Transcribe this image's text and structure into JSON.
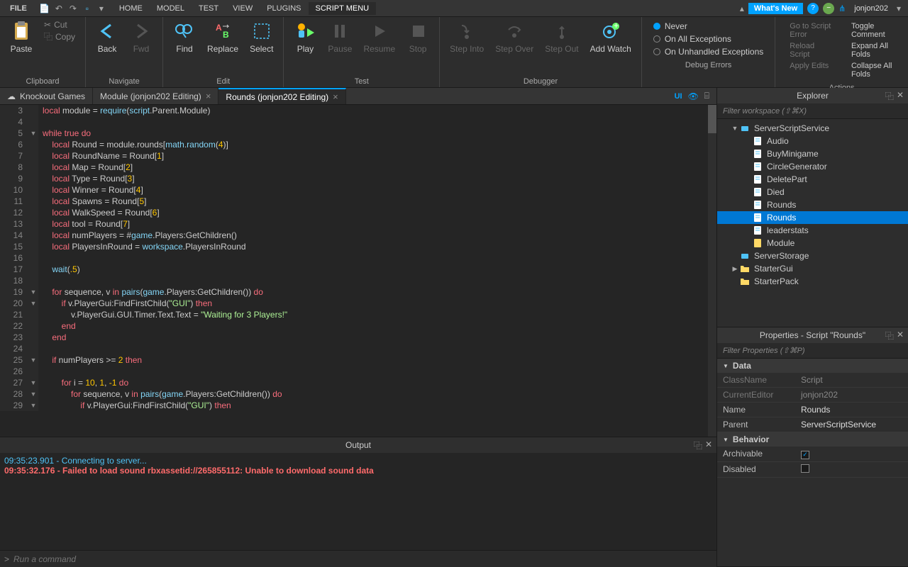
{
  "menubar": {
    "items": [
      "FILE",
      "HOME",
      "MODEL",
      "TEST",
      "VIEW",
      "PLUGINS",
      "SCRIPT MENU"
    ],
    "active": 6,
    "whatsnew": "What's New",
    "username": "jonjon202"
  },
  "ribbon": {
    "clipboard": {
      "paste": "Paste",
      "cut": "Cut",
      "copy": "Copy",
      "label": "Clipboard"
    },
    "navigate": {
      "back": "Back",
      "fwd": "Fwd",
      "label": "Navigate"
    },
    "edit": {
      "find": "Find",
      "replace": "Replace",
      "select": "Select",
      "label": "Edit"
    },
    "test": {
      "play": "Play",
      "pause": "Pause",
      "resume": "Resume",
      "stop": "Stop",
      "label": "Test"
    },
    "debugger": {
      "stepinto": "Step Into",
      "stepover": "Step Over",
      "stepout": "Step Out",
      "addwatch": "Add Watch",
      "label": "Debugger"
    },
    "debugerrors": {
      "never": "Never",
      "allexc": "On All Exceptions",
      "unhandled": "On Unhandled Exceptions",
      "label": "Debug Errors"
    },
    "actions": {
      "gotoerr": "Go to Script Error",
      "reload": "Reload Script",
      "applyedits": "Apply Edits",
      "togglecomment": "Toggle Comment",
      "expandall": "Expand All Folds",
      "collapseall": "Collapse All Folds",
      "label": "Actions"
    }
  },
  "tabs": [
    {
      "label": "Knockout Games",
      "icon": "cloud",
      "active": false,
      "closeable": false
    },
    {
      "label": "Module (jonjon202 Editing)",
      "icon": "",
      "active": false,
      "closeable": true
    },
    {
      "label": "Rounds (jonjon202 Editing)",
      "icon": "",
      "active": true,
      "closeable": true
    }
  ],
  "ui_badge": "UI",
  "code": {
    "lines": [
      {
        "n": 3,
        "f": "",
        "tokens": [
          [
            "kw",
            "local"
          ],
          [
            "ident",
            " module "
          ],
          [
            "ident",
            "= "
          ],
          [
            "fn",
            "require"
          ],
          [
            "ident",
            "("
          ],
          [
            "fn",
            "script"
          ],
          [
            "ident",
            ".Parent.Module)"
          ]
        ]
      },
      {
        "n": 4,
        "f": "",
        "tokens": []
      },
      {
        "n": 5,
        "f": "▼",
        "tokens": [
          [
            "kw",
            "while true do"
          ]
        ]
      },
      {
        "n": 6,
        "f": "",
        "tokens": [
          [
            "ident",
            "    "
          ],
          [
            "kw",
            "local"
          ],
          [
            "ident",
            " Round = module.rounds["
          ],
          [
            "fn",
            "math"
          ],
          [
            "ident",
            "."
          ],
          [
            "fn",
            "random"
          ],
          [
            "ident",
            "("
          ],
          [
            "num",
            "4"
          ],
          [
            "ident",
            ")]"
          ]
        ]
      },
      {
        "n": 7,
        "f": "",
        "tokens": [
          [
            "ident",
            "    "
          ],
          [
            "kw",
            "local"
          ],
          [
            "ident",
            " RoundName = Round["
          ],
          [
            "num",
            "1"
          ],
          [
            "ident",
            "]"
          ]
        ]
      },
      {
        "n": 8,
        "f": "",
        "tokens": [
          [
            "ident",
            "    "
          ],
          [
            "kw",
            "local"
          ],
          [
            "ident",
            " Map = Round["
          ],
          [
            "num",
            "2"
          ],
          [
            "ident",
            "]"
          ]
        ]
      },
      {
        "n": 9,
        "f": "",
        "tokens": [
          [
            "ident",
            "    "
          ],
          [
            "kw",
            "local"
          ],
          [
            "ident",
            " Type = Round["
          ],
          [
            "num",
            "3"
          ],
          [
            "ident",
            "]"
          ]
        ]
      },
      {
        "n": 10,
        "f": "",
        "tokens": [
          [
            "ident",
            "    "
          ],
          [
            "kw",
            "local"
          ],
          [
            "ident",
            " Winner = Round["
          ],
          [
            "num",
            "4"
          ],
          [
            "ident",
            "]"
          ]
        ]
      },
      {
        "n": 11,
        "f": "",
        "tokens": [
          [
            "ident",
            "    "
          ],
          [
            "kw",
            "local"
          ],
          [
            "ident",
            " Spawns = Round["
          ],
          [
            "num",
            "5"
          ],
          [
            "ident",
            "]"
          ]
        ]
      },
      {
        "n": 12,
        "f": "",
        "tokens": [
          [
            "ident",
            "    "
          ],
          [
            "kw",
            "local"
          ],
          [
            "ident",
            " WalkSpeed = Round["
          ],
          [
            "num",
            "6"
          ],
          [
            "ident",
            "]"
          ]
        ]
      },
      {
        "n": 13,
        "f": "",
        "tokens": [
          [
            "ident",
            "    "
          ],
          [
            "kw",
            "local"
          ],
          [
            "ident",
            " tool = Round["
          ],
          [
            "num",
            "7"
          ],
          [
            "ident",
            "]"
          ]
        ]
      },
      {
        "n": 14,
        "f": "",
        "tokens": [
          [
            "ident",
            "    "
          ],
          [
            "kw",
            "local"
          ],
          [
            "ident",
            " numPlayers = #"
          ],
          [
            "fn",
            "game"
          ],
          [
            "ident",
            ".Players:GetChildren()"
          ]
        ]
      },
      {
        "n": 15,
        "f": "",
        "tokens": [
          [
            "ident",
            "    "
          ],
          [
            "kw",
            "local"
          ],
          [
            "ident",
            " PlayersInRound = "
          ],
          [
            "fn",
            "workspace"
          ],
          [
            "ident",
            ".PlayersInRound"
          ]
        ]
      },
      {
        "n": 16,
        "f": "",
        "tokens": []
      },
      {
        "n": 17,
        "f": "",
        "tokens": [
          [
            "ident",
            "    "
          ],
          [
            "fn",
            "wait"
          ],
          [
            "ident",
            "("
          ],
          [
            "num",
            ".5"
          ],
          [
            "ident",
            ")"
          ]
        ]
      },
      {
        "n": 18,
        "f": "",
        "tokens": []
      },
      {
        "n": 19,
        "f": "▼",
        "tokens": [
          [
            "ident",
            "    "
          ],
          [
            "kw",
            "for"
          ],
          [
            "ident",
            " sequence, v "
          ],
          [
            "kw",
            "in"
          ],
          [
            "ident",
            " "
          ],
          [
            "fn",
            "pairs"
          ],
          [
            "ident",
            "("
          ],
          [
            "fn",
            "game"
          ],
          [
            "ident",
            ".Players:GetChildren()) "
          ],
          [
            "kw",
            "do"
          ]
        ]
      },
      {
        "n": 20,
        "f": "▼",
        "tokens": [
          [
            "ident",
            "        "
          ],
          [
            "kw",
            "if"
          ],
          [
            "ident",
            " v.PlayerGui:FindFirstChild("
          ],
          [
            "str",
            "\"GUI\""
          ],
          [
            "ident",
            ") "
          ],
          [
            "kw",
            "then"
          ]
        ]
      },
      {
        "n": 21,
        "f": "",
        "tokens": [
          [
            "ident",
            "            v.PlayerGui.GUI.Timer.Text.Text = "
          ],
          [
            "str",
            "\"Waiting for 3 Players!\""
          ]
        ]
      },
      {
        "n": 22,
        "f": "",
        "tokens": [
          [
            "ident",
            "        "
          ],
          [
            "kw",
            "end"
          ]
        ]
      },
      {
        "n": 23,
        "f": "",
        "tokens": [
          [
            "ident",
            "    "
          ],
          [
            "kw",
            "end"
          ]
        ]
      },
      {
        "n": 24,
        "f": "",
        "tokens": []
      },
      {
        "n": 25,
        "f": "▼",
        "tokens": [
          [
            "ident",
            "    "
          ],
          [
            "kw",
            "if"
          ],
          [
            "ident",
            " numPlayers >= "
          ],
          [
            "num",
            "2"
          ],
          [
            "ident",
            " "
          ],
          [
            "kw",
            "then"
          ]
        ]
      },
      {
        "n": 26,
        "f": "",
        "tokens": []
      },
      {
        "n": 27,
        "f": "▼",
        "tokens": [
          [
            "ident",
            "        "
          ],
          [
            "kw",
            "for"
          ],
          [
            "ident",
            " i = "
          ],
          [
            "num",
            "10"
          ],
          [
            "ident",
            ", "
          ],
          [
            "num",
            "1"
          ],
          [
            "ident",
            ", "
          ],
          [
            "num",
            "-1"
          ],
          [
            "ident",
            " "
          ],
          [
            "kw",
            "do"
          ]
        ]
      },
      {
        "n": 28,
        "f": "▼",
        "tokens": [
          [
            "ident",
            "            "
          ],
          [
            "kw",
            "for"
          ],
          [
            "ident",
            " sequence, v "
          ],
          [
            "kw",
            "in"
          ],
          [
            "ident",
            " "
          ],
          [
            "fn",
            "pairs"
          ],
          [
            "ident",
            "("
          ],
          [
            "fn",
            "game"
          ],
          [
            "ident",
            ".Players:GetChildren()) "
          ],
          [
            "kw",
            "do"
          ]
        ]
      },
      {
        "n": 29,
        "f": "▼",
        "tokens": [
          [
            "ident",
            "                "
          ],
          [
            "kw",
            "if"
          ],
          [
            "ident",
            " v.PlayerGui:FindFirstChild("
          ],
          [
            "str",
            "\"GUI\""
          ],
          [
            "ident",
            ") "
          ],
          [
            "kw",
            "then"
          ]
        ]
      }
    ]
  },
  "output": {
    "title": "Output",
    "lines": [
      {
        "cls": "log-info",
        "text": "09:35:23.901 - Connecting to server..."
      },
      {
        "cls": "log-err",
        "text": "09:35:32.176 - Failed to load sound rbxassetid://265855112: Unable to download sound data"
      }
    ]
  },
  "command": {
    "placeholder": "Run a command",
    "prefix": ">"
  },
  "explorer": {
    "title": "Explorer",
    "filter": "Filter workspace (⇧⌘X)",
    "items": [
      {
        "depth": 0,
        "arrow": "▼",
        "icon": "service",
        "label": "ServerScriptService",
        "sel": false
      },
      {
        "depth": 1,
        "arrow": "",
        "icon": "script",
        "label": "Audio",
        "sel": false
      },
      {
        "depth": 1,
        "arrow": "",
        "icon": "script",
        "label": "BuyMinigame",
        "sel": false
      },
      {
        "depth": 1,
        "arrow": "",
        "icon": "script",
        "label": "CircleGenerator",
        "sel": false
      },
      {
        "depth": 1,
        "arrow": "",
        "icon": "script",
        "label": "DeletePart",
        "sel": false
      },
      {
        "depth": 1,
        "arrow": "",
        "icon": "script",
        "label": "Died",
        "sel": false
      },
      {
        "depth": 1,
        "arrow": "",
        "icon": "script",
        "label": "Rounds",
        "sel": false
      },
      {
        "depth": 1,
        "arrow": "",
        "icon": "script",
        "label": "Rounds",
        "sel": true
      },
      {
        "depth": 1,
        "arrow": "",
        "icon": "script",
        "label": "leaderstats",
        "sel": false
      },
      {
        "depth": 1,
        "arrow": "",
        "icon": "module",
        "label": "Module",
        "sel": false
      },
      {
        "depth": 0,
        "arrow": "",
        "icon": "service",
        "label": "ServerStorage",
        "sel": false
      },
      {
        "depth": 0,
        "arrow": "▶",
        "icon": "folder",
        "label": "StarterGui",
        "sel": false
      },
      {
        "depth": 0,
        "arrow": "",
        "icon": "folder",
        "label": "StarterPack",
        "sel": false
      }
    ]
  },
  "properties": {
    "title": "Properties - Script \"Rounds\"",
    "filter": "Filter Properties (⇧⌘P)",
    "sections": [
      {
        "name": "Data",
        "rows": [
          {
            "name": "ClassName",
            "val": "Script",
            "dim": true
          },
          {
            "name": "CurrentEditor",
            "val": "jonjon202",
            "dim": true
          },
          {
            "name": "Name",
            "val": "Rounds",
            "dim": false
          },
          {
            "name": "Parent",
            "val": "ServerScriptService",
            "dim": false
          }
        ]
      },
      {
        "name": "Behavior",
        "rows": [
          {
            "name": "Archivable",
            "val": "✓",
            "dim": false,
            "checkbox": true,
            "checked": true
          },
          {
            "name": "Disabled",
            "val": "",
            "dim": false,
            "checkbox": true,
            "checked": false
          }
        ]
      }
    ]
  }
}
